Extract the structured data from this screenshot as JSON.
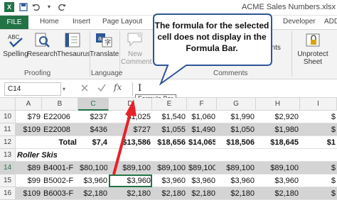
{
  "title": "ACME Sales Numbers.xlsx",
  "qat": {
    "save_icon": "save-icon",
    "undo_icon": "undo-icon",
    "redo_icon": "redo-icon",
    "excel_icon": "excel-icon"
  },
  "tabs": {
    "file": "FILE",
    "home": "Home",
    "insert": "Insert",
    "page_layout": "Page Layout",
    "developer": "Developer",
    "addins": "ADD"
  },
  "ribbon": {
    "spelling": "Spelling",
    "research": "Research",
    "thesaurus": "Thesaurus",
    "translate": "Translate",
    "new_comment_1": "New",
    "new_comment_2": "Comment",
    "unprotect_1": "Unprotect",
    "unprotect_2": "Sheet",
    "show_right": "ents",
    "proofing": "Proofing",
    "language": "Language",
    "comments": "Comments"
  },
  "formula_bar": {
    "name_box": "C14",
    "fx": "fx",
    "tooltip": "Formula Bar"
  },
  "callout": {
    "text": "The formula for the selected cell does not display in the Formula Bar."
  },
  "columns": [
    "A",
    "B",
    "C",
    "D",
    "E",
    "F",
    "G",
    "H",
    "I"
  ],
  "selected_column": "C",
  "rows": [
    {
      "num": "10",
      "shade": false,
      "cells": [
        "$79",
        "E22006",
        "$237",
        "$1,025",
        "$1,540",
        "$1,060",
        "$1,990",
        "$2,920",
        "$"
      ]
    },
    {
      "num": "11",
      "shade": true,
      "cells": [
        "$109",
        "E22008",
        "$436",
        "$727",
        "$1,055",
        "$1,490",
        "$1,050",
        "$1,980",
        "$"
      ]
    },
    {
      "num": "12",
      "shade": false,
      "bold": true,
      "cells": [
        "",
        "Total",
        "$7,4",
        "$13,586",
        "$18,656",
        "$14,065",
        "$18,506",
        "$18,645",
        "$1"
      ]
    },
    {
      "num": "13",
      "shade": false,
      "cells": [
        "Roller Skis",
        "",
        "",
        "",
        "",
        "",
        "",
        "",
        ""
      ]
    },
    {
      "num": "14",
      "shade": true,
      "cells": [
        "$89",
        "B4001-F",
        "$80,100",
        "$89,100",
        "$89,100",
        "$89,100",
        "$89,100",
        "$89,100",
        "$"
      ]
    },
    {
      "num": "15",
      "shade": false,
      "cells": [
        "$99",
        "B5002-F",
        "$3,960",
        "$3,960",
        "$3,960",
        "$3,960",
        "$3,960",
        "$3,960",
        "$"
      ]
    },
    {
      "num": "16",
      "shade": true,
      "cells": [
        "$109",
        "B6003-F",
        "$2,180",
        "$2,180",
        "$2,180",
        "$2,180",
        "$2,180",
        "$2,180",
        "$"
      ]
    }
  ],
  "colors": {
    "excel_green": "#217346",
    "callout_border": "#2f5597",
    "arrow_red": "#e8202a"
  }
}
